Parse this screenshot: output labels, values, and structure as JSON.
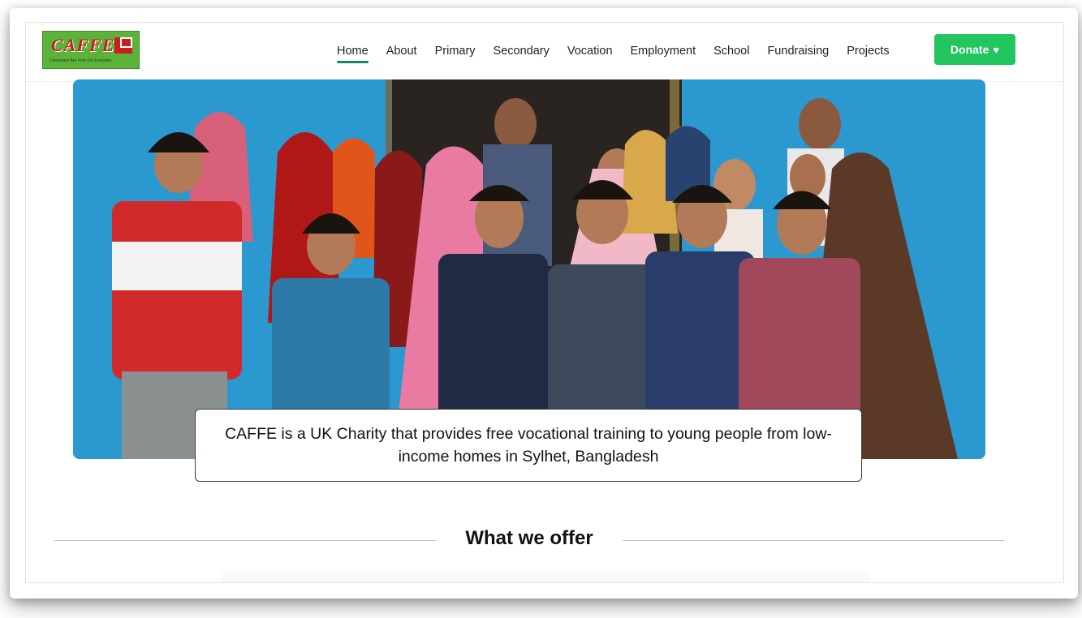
{
  "header": {
    "logo": {
      "wordmark": "CAFFE",
      "tagline": "Computers Are Free For Everyone"
    },
    "nav": [
      {
        "label": "Home",
        "active": true
      },
      {
        "label": "About"
      },
      {
        "label": "Primary"
      },
      {
        "label": "Secondary"
      },
      {
        "label": "Vocation"
      },
      {
        "label": "Employment"
      },
      {
        "label": "School"
      },
      {
        "label": "Fundraising"
      },
      {
        "label": "Projects"
      }
    ],
    "donate_label": "Donate",
    "donate_icon": "heart-icon"
  },
  "hero": {
    "caption": "CAFFE is a UK Charity that provides free vocational training to young people from low-income homes in Sylhet, Bangladesh"
  },
  "sections": {
    "offer_title": "What we offer"
  },
  "colors": {
    "accent": "#22c55e",
    "nav_active": "#198754",
    "logo_bg": "#5cb33a",
    "logo_text": "#c81e1e",
    "hero_wall": "#2b98cf"
  }
}
